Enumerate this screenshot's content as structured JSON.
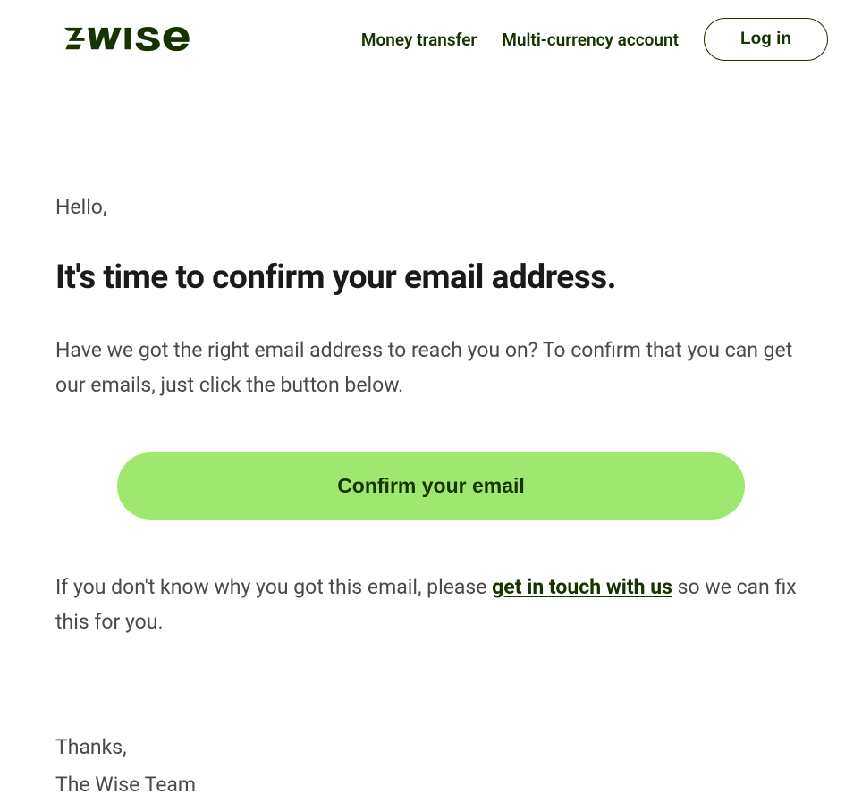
{
  "header": {
    "logo_text": "WISE",
    "nav": {
      "money_transfer": "Money transfer",
      "multi_currency": "Multi-currency account",
      "login": "Log in"
    }
  },
  "content": {
    "greeting": "Hello,",
    "title": "It's time to confirm your email address.",
    "body": "Have we got the right email address to reach you on? To confirm that you can get our emails, just click the button below.",
    "cta_label": "Confirm your email",
    "secondary_before": "If you don't know why you got this email, please ",
    "secondary_link": "get in touch with us",
    "secondary_after": " so we can fix this for you.",
    "thanks": "Thanks,",
    "team": "The Wise Team"
  },
  "colors": {
    "brand_dark": "#163300",
    "brand_green": "#9fe870",
    "text_body": "#4a4a4a"
  }
}
